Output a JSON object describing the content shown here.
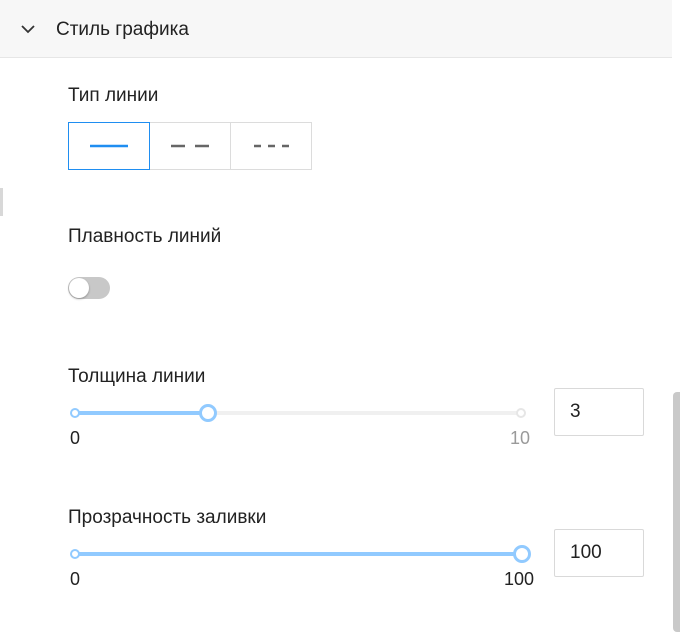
{
  "section": {
    "title": "Стиль графика",
    "expanded": true
  },
  "line_type": {
    "label": "Тип линии",
    "options": [
      {
        "name": "solid",
        "selected": true
      },
      {
        "name": "dashed",
        "selected": false
      },
      {
        "name": "dotted",
        "selected": false
      }
    ]
  },
  "smoothing": {
    "label": "Плавность линий",
    "enabled": false
  },
  "line_width": {
    "label": "Толщина линии",
    "min": 0,
    "max": 10,
    "value": 3,
    "min_label": "0",
    "max_label": "10",
    "input_value": "3"
  },
  "fill_opacity": {
    "label": "Прозрачность заливки",
    "min": 0,
    "max": 100,
    "value": 100,
    "min_label": "0",
    "max_label": "100",
    "input_value": "100"
  },
  "colors": {
    "accent": "#1f8ef1",
    "slider_track": "#91caff",
    "toggle_off": "#c8c8c8"
  }
}
